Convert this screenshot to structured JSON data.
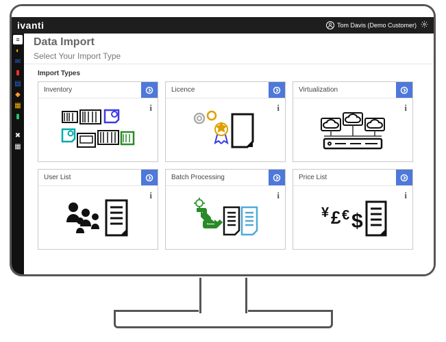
{
  "header": {
    "brand": "ivanti",
    "user_name": "Tom Davis (Demo Customer)"
  },
  "page": {
    "title": "Data Import",
    "subtitle": "Select Your Import Type",
    "section_label": "Import Types"
  },
  "sidebar": {
    "items_count": 10
  },
  "cards": [
    {
      "title": "Inventory"
    },
    {
      "title": "Licence"
    },
    {
      "title": "Virtualization"
    },
    {
      "title": "User List"
    },
    {
      "title": "Batch Processing"
    },
    {
      "title": "Price List"
    }
  ],
  "info_glyph": "i"
}
